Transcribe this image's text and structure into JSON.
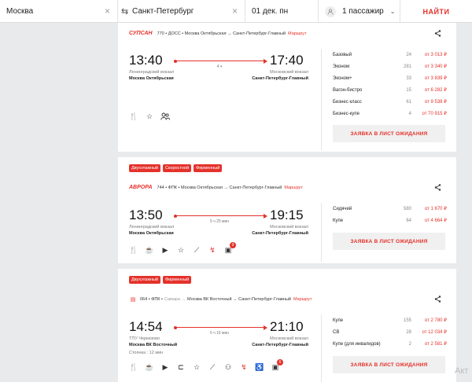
{
  "search": {
    "from": "Москва",
    "to": "Санкт-Петербург",
    "date": "01 дек. пн",
    "passengers": "1 пассажир",
    "find_label": "НАЙТИ"
  },
  "trains": [
    {
      "brand": "СУПСАН",
      "info": "770 • ДОСС • Москва Октябрьская → Санкт-Петербург-Главный",
      "route_link": "Маршрут",
      "depart_time": "13:40",
      "arrive_time": "17:40",
      "duration": "4 ч",
      "depart_station": "Ленинградский вокзал",
      "depart_city": "Москва Октябрьская",
      "arrive_station": "Московский вокзал",
      "arrive_city": "Санкт-Петербург-Главный",
      "fares": [
        {
          "cls": "Базовый",
          "count": "24",
          "price": "от 3 013 ₽"
        },
        {
          "cls": "Эконом",
          "count": "281",
          "price": "от 3 340 ₽"
        },
        {
          "cls": "Эконом+",
          "count": "33",
          "price": "от 3 839 ₽"
        },
        {
          "cls": "Вагон-бистро",
          "count": "15",
          "price": "от 6 282 ₽"
        },
        {
          "cls": "Бизнес класс",
          "count": "61",
          "price": "от 9 538 ₽"
        },
        {
          "cls": "Бизнес-купе",
          "count": "4",
          "price": "от 70 915 ₽"
        }
      ],
      "wait_label": "ЗАЯВКА В ЛИСТ ОЖИДАНИЯ"
    },
    {
      "badges": [
        "Двухэтажный",
        "Скоростной",
        "Фирменный"
      ],
      "brand": "АВРОРА",
      "info": "744 • ФПК • Москва Октябрьская → Санкт-Петербург-Главный",
      "route_link": "Маршрут",
      "depart_time": "13:50",
      "arrive_time": "19:15",
      "duration": "5 ч 25 мин",
      "depart_station": "Ленинградский вокзал",
      "depart_city": "Москва Октябрьская",
      "arrive_station": "Московский вокзал",
      "arrive_city": "Санкт-Петербург-Главный",
      "fares": [
        {
          "cls": "Сидячий",
          "count": "580",
          "price": "от 1 670 ₽"
        },
        {
          "cls": "Купе",
          "count": "64",
          "price": "от 4 664 ₽"
        }
      ],
      "icon_count": "9",
      "wait_label": "ЗАЯВКА В ЛИСТ ОЖИДАНИЯ"
    },
    {
      "badges": [
        "Двухэтажный",
        "Фирменный"
      ],
      "info_prefix": "064 • ФПК •",
      "info_origin": "Самара →",
      "info_route": "Москва ВК Восточный → Санкт-Петербург-Главный",
      "route_link": "Маршрут",
      "depart_time": "14:54",
      "arrive_time": "21:10",
      "duration": "6 ч 16 мин",
      "depart_station": "ТПУ Черкизово",
      "depart_city": "Москва ВК Восточный",
      "stop": "Стоянка : 12 мин",
      "arrive_station": "Московский вокзал",
      "arrive_city": "Санкт-Петербург-Главный",
      "fares": [
        {
          "cls": "Купе",
          "count": "155",
          "price": "от 2 780 ₽"
        },
        {
          "cls": "СВ",
          "count": "28",
          "price": "от 12 034 ₽"
        },
        {
          "cls": "Купе (для инвалидов)",
          "count": "2",
          "price": "от 2 581 ₽"
        }
      ],
      "icon_count": "6",
      "wait_label": "ЗАЯВКА В ЛИСТ ОЖИДАНИЯ"
    }
  ],
  "watermark": "Акт"
}
